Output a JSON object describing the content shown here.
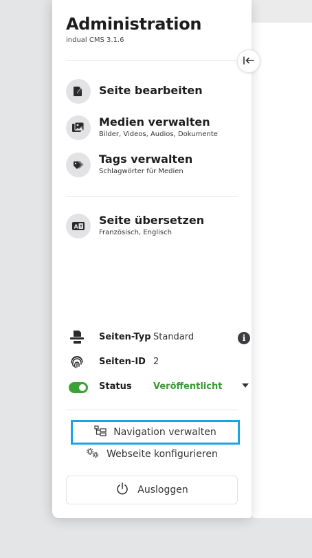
{
  "header": {
    "title": "Administration",
    "subtitle": "indual CMS 3.1.6"
  },
  "collapse": {
    "icon": "collapse-left-icon"
  },
  "menu": [
    {
      "title": "Seite bearbeiten",
      "sub": "",
      "icon": "edit-page-icon"
    },
    {
      "title": "Medien verwalten",
      "sub": "Bilder, Videos, Audios, Dokumente",
      "icon": "media-icon"
    },
    {
      "title": "Tags verwalten",
      "sub": "Schlagwörter für Medien",
      "icon": "tag-icon"
    },
    {
      "title": "Seite übersetzen",
      "sub": "Französisch, Englisch",
      "icon": "translate-icon"
    }
  ],
  "page_info": {
    "type_label": "Seiten-Typ",
    "type_value": "Standard",
    "id_label": "Seiten-ID",
    "id_value": "2",
    "status_label": "Status",
    "status_value": "Veröffentlicht",
    "status_on": true
  },
  "colors": {
    "accent_green": "#3ba236",
    "highlight_blue": "#1aa3e8"
  },
  "actions": {
    "navigation": "Navigation verwalten",
    "configure": "Webseite konfigurieren",
    "logout": "Ausloggen"
  }
}
